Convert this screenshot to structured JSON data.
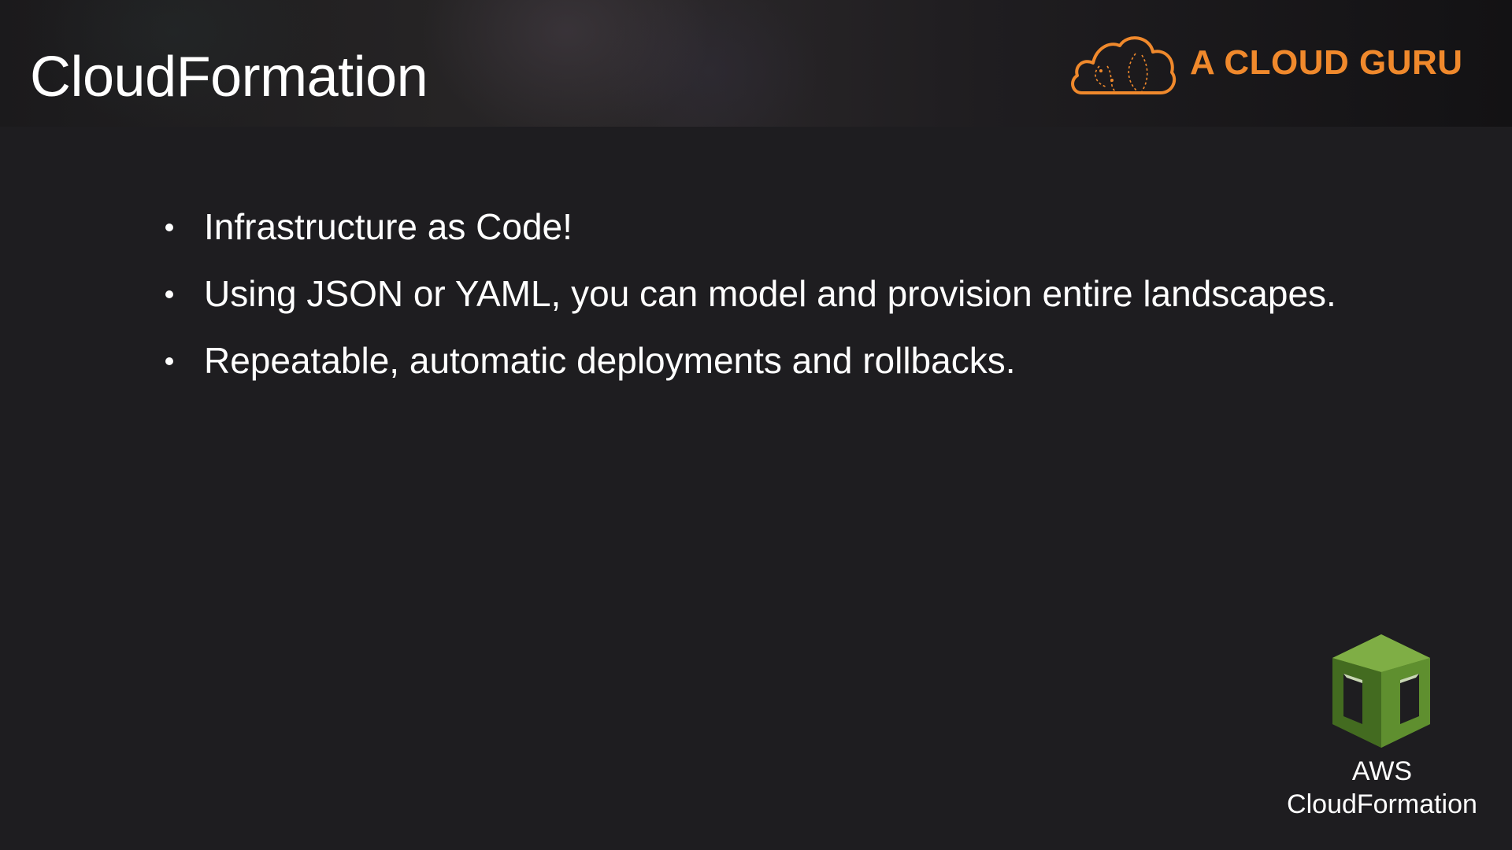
{
  "slide": {
    "title": "CloudFormation",
    "brand": {
      "name": "A CLOUD GURU",
      "logo_icon": "cloud-logo-icon",
      "accent_color": "#f0892c"
    },
    "bullets": [
      "Infrastructure as Code!",
      "Using JSON or YAML, you can model and provision entire landscapes.",
      "Repeatable, automatic deployments and rollbacks."
    ],
    "service_badge": {
      "icon": "aws-cloudformation-icon",
      "line1": "AWS",
      "line2": "CloudFormation",
      "icon_color": "#5b8a2f"
    },
    "colors": {
      "background": "#1e1d20",
      "text": "#ffffff"
    }
  }
}
